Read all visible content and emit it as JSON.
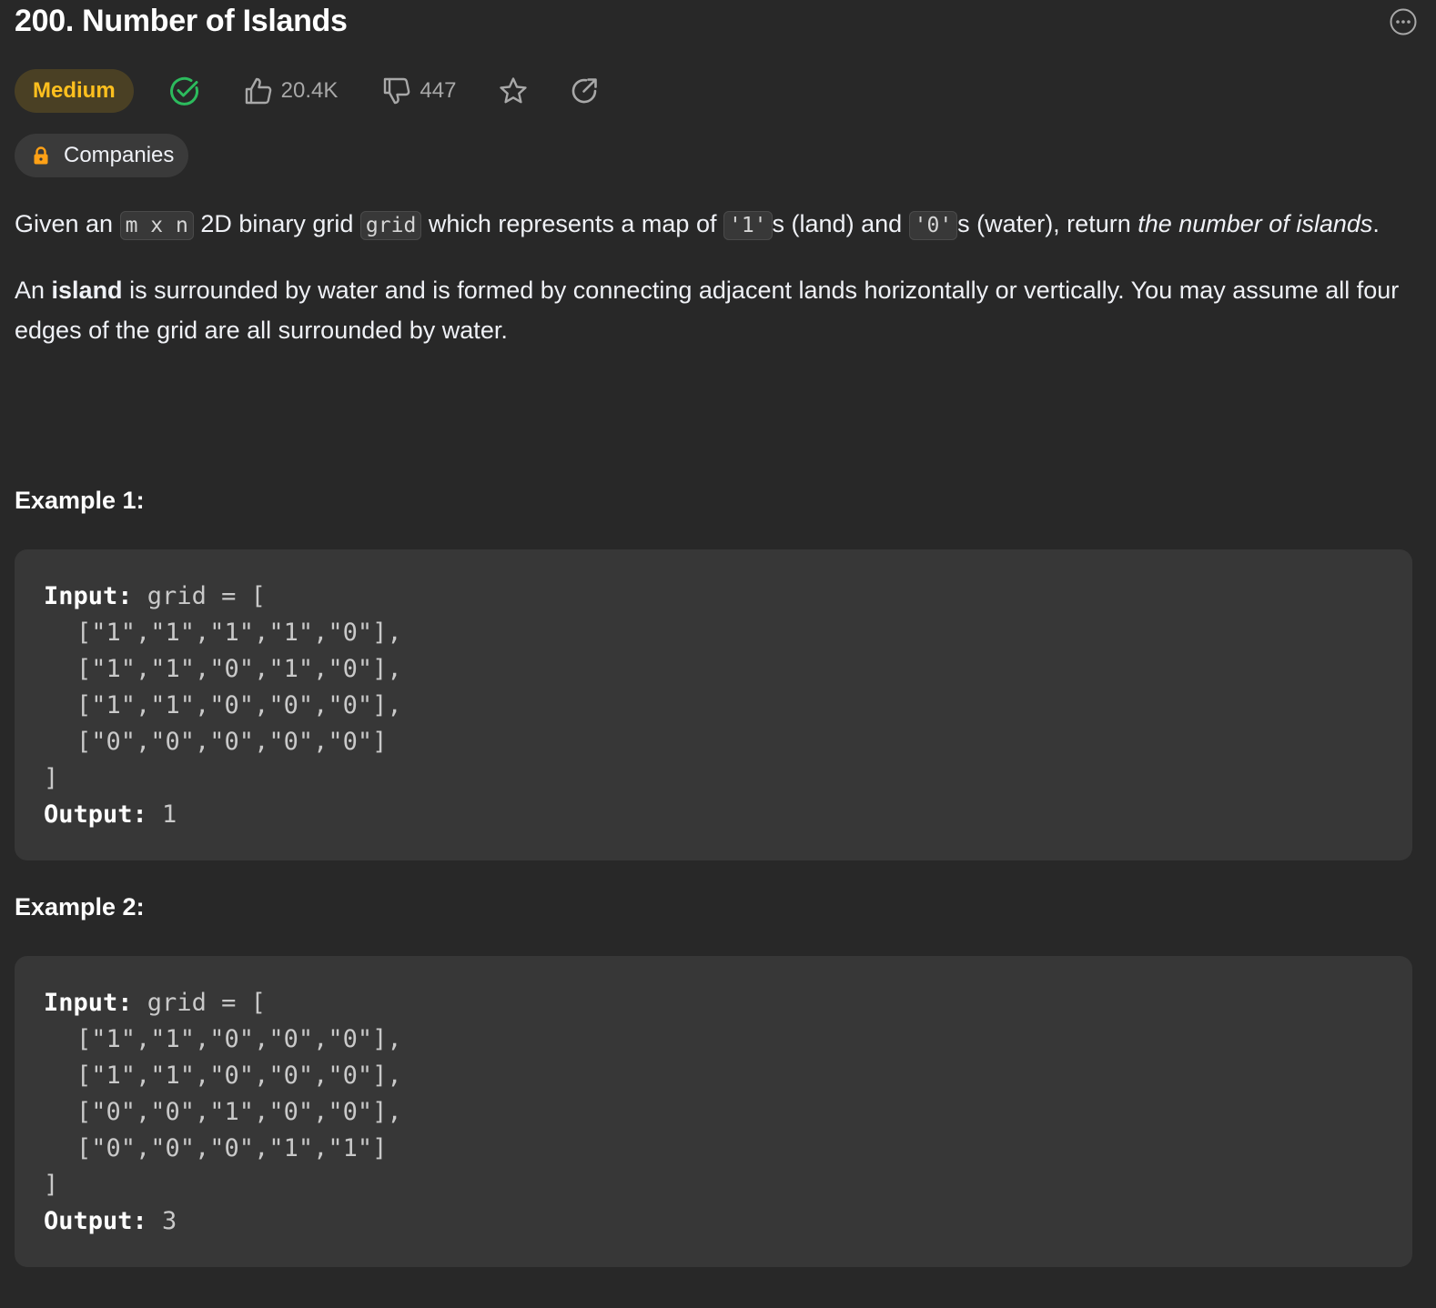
{
  "problem": {
    "title": "200. Number of Islands",
    "difficulty": "Medium",
    "likes": "20.4K",
    "dislikes": "447",
    "companies_label": "Companies"
  },
  "description": {
    "p1": {
      "t1": "Given an ",
      "c1": "m x n",
      "t2": " 2D binary grid ",
      "c2": "grid",
      "t3": " which represents a map of ",
      "c3": "'1'",
      "t4": "s (land) and ",
      "c4": "'0'",
      "t5": "s (water), return ",
      "em": "the number of islands",
      "t6": "."
    },
    "p2": {
      "t1": "An ",
      "strong": "island",
      "t2": " is surrounded by water and is formed by connecting adjacent lands horizontally or vertically. You may assume all four edges of the grid are all surrounded by water."
    }
  },
  "examples": [
    {
      "heading": "Example 1:",
      "input_label": "Input:",
      "input_open": " grid = [",
      "rows": [
        "[\"1\",\"1\",\"1\",\"1\",\"0\"],",
        "[\"1\",\"1\",\"0\",\"1\",\"0\"],",
        "[\"1\",\"1\",\"0\",\"0\",\"0\"],",
        "[\"0\",\"0\",\"0\",\"0\",\"0\"]"
      ],
      "input_close": "]",
      "output_label": "Output:",
      "output_value": " 1"
    },
    {
      "heading": "Example 2:",
      "input_label": "Input:",
      "input_open": " grid = [",
      "rows": [
        "[\"1\",\"1\",\"0\",\"0\",\"0\"],",
        "[\"1\",\"1\",\"0\",\"0\",\"0\"],",
        "[\"0\",\"0\",\"1\",\"0\",\"0\"],",
        "[\"0\",\"0\",\"0\",\"1\",\"1\"]"
      ],
      "input_close": "]",
      "output_label": "Output:",
      "output_value": " 3"
    }
  ],
  "colors": {
    "background": "#282828",
    "difficulty_medium": "#ffc01e",
    "solved_green": "#2cbb5d",
    "lock_orange": "#ffa116"
  },
  "icons": [
    "more-icon",
    "solved-check-icon",
    "thumbs-up-icon",
    "thumbs-down-icon",
    "star-icon",
    "share-icon",
    "lock-icon"
  ]
}
